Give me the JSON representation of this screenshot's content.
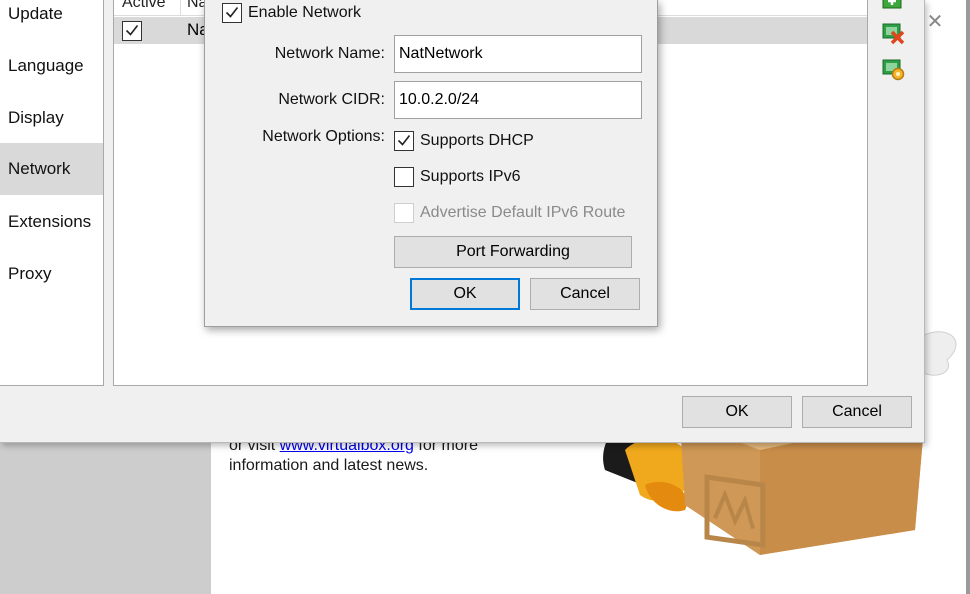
{
  "manager": {
    "welcome_line1_prefix": "or visit ",
    "welcome_link": "www.virtualbox.org",
    "welcome_line1_suffix": " for more",
    "welcome_line2": "information and latest news."
  },
  "settings": {
    "sidebar": {
      "items": [
        {
          "label": "Update"
        },
        {
          "label": "Language"
        },
        {
          "label": "Display"
        },
        {
          "label": "Network",
          "selected": true
        },
        {
          "label": "Extensions"
        },
        {
          "label": "Proxy"
        }
      ]
    },
    "table": {
      "columns": [
        "Active",
        "Name"
      ],
      "rows": [
        {
          "active": true,
          "name": "Na"
        }
      ]
    },
    "toolbar_icons": [
      "add-network-icon",
      "remove-network-icon",
      "edit-network-icon"
    ],
    "ok_label": "OK",
    "cancel_label": "Cancel"
  },
  "nat_dialog": {
    "enable_network_label": "Enable Network",
    "enable_network_checked": true,
    "network_name_label": "Network Name:",
    "network_name_value": "NatNetwork",
    "network_cidr_label": "Network CIDR:",
    "network_cidr_value": "10.0.2.0/24",
    "network_options_label": "Network Options:",
    "supports_dhcp_label": "Supports DHCP",
    "supports_dhcp_checked": true,
    "supports_ipv6_label": "Supports IPv6",
    "supports_ipv6_checked": false,
    "advertise_route_label": "Advertise Default IPv6 Route",
    "advertise_route_enabled": false,
    "port_forwarding_label": "Port Forwarding",
    "ok_label": "OK",
    "cancel_label": "Cancel"
  },
  "colors": {
    "accent": "#0078d7",
    "selection": "#d9d9d9",
    "dialog_bg": "#f0f0f0",
    "link": "#0000ee"
  }
}
